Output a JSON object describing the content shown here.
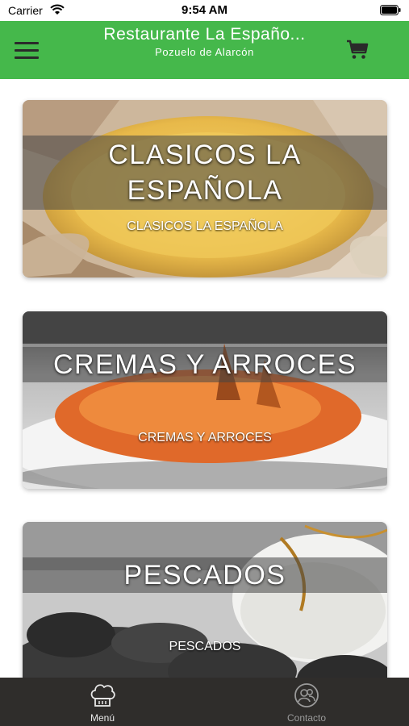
{
  "status_bar": {
    "carrier": "Carrier",
    "time": "9:54 AM"
  },
  "header": {
    "title": "Restaurante La Españo...",
    "subtitle": "Pozuelo de Alarcón",
    "color": "#45b84b"
  },
  "categories": [
    {
      "title": "CLASICOS LA ESPAÑOLA",
      "subtitle": "CLASICOS LA ESPAÑOLA"
    },
    {
      "title": "CREMAS Y ARROCES",
      "subtitle": "CREMAS Y ARROCES"
    },
    {
      "title": "PESCADOS",
      "subtitle": "PESCADOS"
    }
  ],
  "tab_bar": {
    "tabs": [
      {
        "label": "Menú",
        "icon": "chef-hat-icon"
      },
      {
        "label": "Contacto",
        "icon": "contact-icon"
      }
    ]
  }
}
